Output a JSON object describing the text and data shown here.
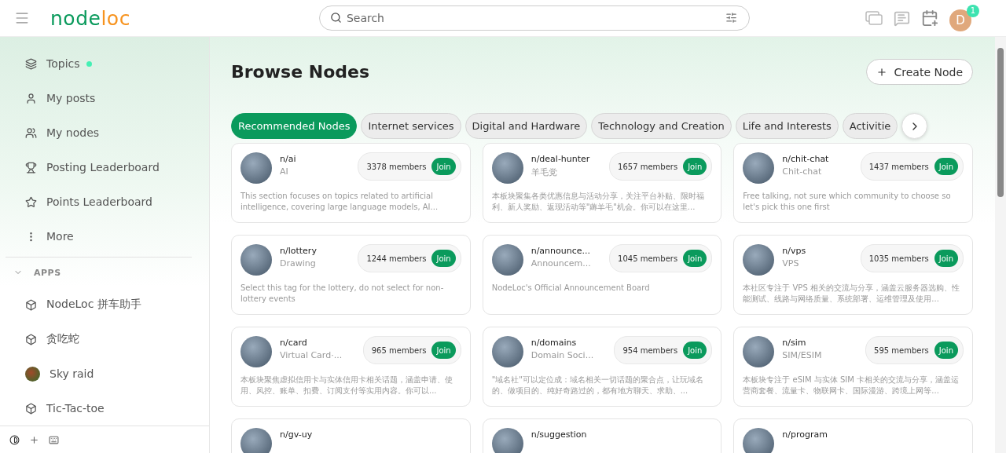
{
  "header": {
    "logo": {
      "part_1": "node",
      "part_2": "loc"
    },
    "search": {
      "placeholder": "Search"
    },
    "avatar": {
      "initial": "D",
      "badge": "1"
    }
  },
  "sidebar": {
    "items": [
      {
        "kind": "layers",
        "label": "Topics",
        "unread": true
      },
      {
        "kind": "user",
        "label": "My posts",
        "unread": false
      },
      {
        "kind": "users",
        "label": "My nodes",
        "unread": false
      },
      {
        "kind": "trophy",
        "label": "Posting Leaderboard",
        "unread": false
      },
      {
        "kind": "star",
        "label": "Points Leaderboard",
        "unread": false
      },
      {
        "kind": "more",
        "label": "More",
        "unread": false
      }
    ],
    "apps_section": {
      "title": "APPS",
      "expanded": true,
      "items": [
        {
          "kind": "app",
          "label": "NodeLoc 拼车助手"
        },
        {
          "kind": "app",
          "label": "贪吃蛇"
        },
        {
          "kind": "image",
          "label": "Sky raid"
        },
        {
          "kind": "app",
          "label": "Tic-Tac-toe"
        }
      ]
    }
  },
  "main": {
    "title": "Browse Nodes",
    "create_button": "Create Node",
    "tabs": [
      {
        "label": "Recommended Nodes",
        "selected": true
      },
      {
        "label": "Internet services",
        "selected": false
      },
      {
        "label": "Digital and Hardware",
        "selected": false
      },
      {
        "label": "Technology and Creation",
        "selected": false
      },
      {
        "label": "Life and Interests",
        "selected": false
      },
      {
        "label": "Activitie",
        "selected": false
      }
    ],
    "nodes": [
      {
        "name": "n/ai",
        "subtitle": "AI",
        "members": "3378 members",
        "join": "Join",
        "description": "This section focuses on topics related to artificial intelligence, covering large language models, AI..."
      },
      {
        "name": "n/deal-hunter",
        "subtitle": "羊毛党",
        "members": "1657 members",
        "join": "Join",
        "description": "本板块聚集各类优惠信息与活动分享，关注平台补贴、限时福利、新人奖励、返现活动等\"薅羊毛\"机会。你可以在这里..."
      },
      {
        "name": "n/chit-chat",
        "subtitle": "Chit-chat",
        "members": "1437 members",
        "join": "Join",
        "description": "Free talking, not sure which community to choose so let's pick this one first"
      },
      {
        "name": "n/lottery",
        "subtitle": "Drawing",
        "members": "1244 members",
        "join": "Join",
        "description": "Select this tag for the lottery, do not select for non-lottery events"
      },
      {
        "name": "n/announce...",
        "subtitle": "Announcem...",
        "members": "1045 members",
        "join": "Join",
        "description": "NodeLoc's Official Announcement Board"
      },
      {
        "name": "n/vps",
        "subtitle": "VPS",
        "members": "1035 members",
        "join": "Join",
        "description": "本社区专注于 VPS 相关的交流与分享，涵盖云服务器选购、性能测试、线路与网络质量、系统部署、运维管理及使用..."
      },
      {
        "name": "n/card",
        "subtitle": "Virtual Card·...",
        "members": "965 members",
        "join": "Join",
        "description": "本板块聚焦虚拟信用卡与实体信用卡相关话题，涵盖申请、使用、风控、账单、扣费、订阅支付等实用内容。你可以..."
      },
      {
        "name": "n/domains",
        "subtitle": "Domain Soci...",
        "members": "954 members",
        "join": "Join",
        "description": "\"域名社\"可以定位成：域名相关一切话题的聚合点，让玩域名的、做项目的、纯好奇路过的，都有地方聊天、求助、..."
      },
      {
        "name": "n/sim",
        "subtitle": "SIM/ESIM",
        "members": "595 members",
        "join": "Join",
        "description": "本板块专注于 eSIM 与实体 SIM 卡相关的交流与分享，涵盖运营商套餐、流量卡、物联网卡、国际漫游、跨境上网等..."
      },
      {
        "name": "n/gv-uy"
      },
      {
        "name": "n/suggestion"
      },
      {
        "name": "n/program"
      }
    ]
  }
}
